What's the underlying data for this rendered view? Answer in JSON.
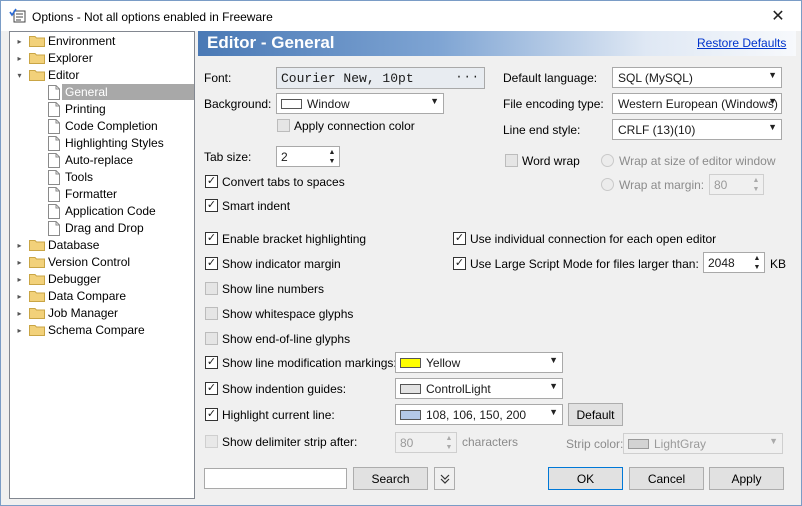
{
  "window": {
    "title": "Options - Not all options enabled in Freeware",
    "close_glyph": "✕"
  },
  "tree": {
    "items": [
      {
        "label": "Environment",
        "level": 0,
        "expander": "▸"
      },
      {
        "label": "Explorer",
        "level": 0,
        "expander": "▸"
      },
      {
        "label": "Editor",
        "level": 0,
        "expander": "▾"
      },
      {
        "label": "General",
        "level": 1,
        "selected": true
      },
      {
        "label": "Printing",
        "level": 1
      },
      {
        "label": "Code Completion",
        "level": 1
      },
      {
        "label": "Highlighting Styles",
        "level": 1
      },
      {
        "label": "Auto-replace",
        "level": 1
      },
      {
        "label": "Tools",
        "level": 1
      },
      {
        "label": "Formatter",
        "level": 1
      },
      {
        "label": "Application Code",
        "level": 1
      },
      {
        "label": "Drag and Drop",
        "level": 1
      },
      {
        "label": "Database",
        "level": 0,
        "expander": "▸"
      },
      {
        "label": "Version Control",
        "level": 0,
        "expander": "▸"
      },
      {
        "label": "Debugger",
        "level": 0,
        "expander": "▸"
      },
      {
        "label": "Data Compare",
        "level": 0,
        "expander": "▸"
      },
      {
        "label": "Job Manager",
        "level": 0,
        "expander": "▸"
      },
      {
        "label": "Schema Compare",
        "level": 0,
        "expander": "▸"
      }
    ]
  },
  "header": {
    "title": "Editor - General",
    "restore_label": "Restore Defaults"
  },
  "general": {
    "font_label": "Font:",
    "font_value": "Courier New, 10pt",
    "font_button": "···",
    "background_label": "Background:",
    "background_value": "Window",
    "background_color": "#ffffff",
    "apply_conn_color": "Apply connection color",
    "tab_size_label": "Tab size:",
    "tab_size_value": "2",
    "convert_tabs": "Convert tabs to spaces",
    "smart_indent": "Smart indent",
    "default_language_label": "Default language:",
    "default_language_value": "SQL (MySQL)",
    "file_encoding_label": "File encoding type:",
    "file_encoding_value": "Western European (Windows)",
    "line_end_label": "Line end style:",
    "line_end_value": "CRLF (13)(10)",
    "word_wrap": "Word wrap",
    "wrap_editor": "Wrap at size of editor window",
    "wrap_margin": "Wrap at margin:",
    "wrap_margin_value": "80"
  },
  "options": {
    "bracket": "Enable bracket highlighting",
    "indicator_margin": "Show indicator margin",
    "line_numbers": "Show line numbers",
    "whitespace": "Show whitespace glyphs",
    "eol": "Show end-of-line glyphs",
    "line_mod": "Show line modification markings:",
    "line_mod_value": "Yellow",
    "line_mod_color": "#ffff00",
    "indent_guides": "Show indention guides:",
    "indent_guides_value": "ControlLight",
    "indent_guides_color": "#e3e3e3",
    "highlight_line": "Highlight current line:",
    "highlight_line_value": "108, 106, 150, 200",
    "highlight_line_color": "#b4c8e6",
    "default_button": "Default",
    "delimiter": "Show delimiter strip after:",
    "delimiter_value": "80",
    "characters": "characters",
    "strip_color_label": "Strip color:",
    "strip_color_value": "LightGray",
    "strip_color": "#d3d3d3",
    "individual_conn": "Use individual connection for each open editor",
    "large_script": "Use Large Script Mode for files larger than:",
    "large_script_value": "2048",
    "kb": "KB"
  },
  "footer": {
    "search_placeholder": "",
    "search_button": "Search",
    "ok": "OK",
    "cancel": "Cancel",
    "apply": "Apply"
  }
}
